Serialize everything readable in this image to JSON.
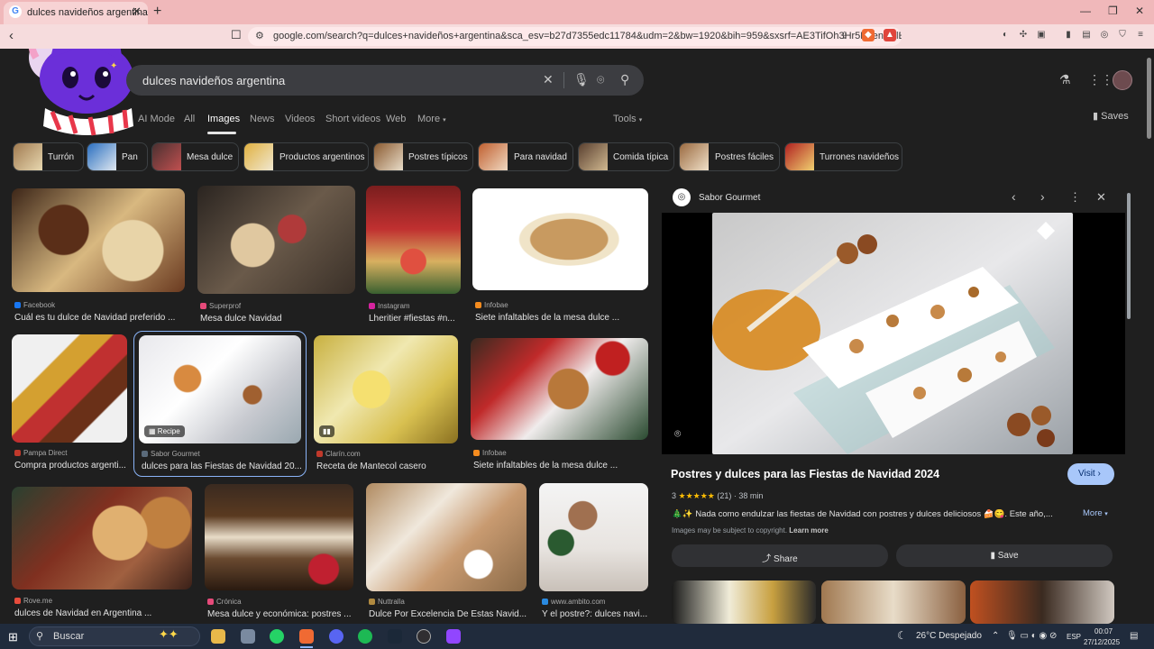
{
  "browser": {
    "tab_title": "dulces navideños argentina",
    "url": "google.com/search?q=dulces+navideños+argentina&sca_esv=b27d7355edc11784&udm=2&bw=1920&bih=959&sxsrf=AE3TifOh3Hr5K7engNlE8to...",
    "google_logo_letter": "G"
  },
  "search": {
    "query": "dulces navideños argentina"
  },
  "header": {
    "saves_label": "Saves"
  },
  "nav_tabs": [
    "AI Mode",
    "All",
    "Images",
    "News",
    "Videos",
    "Short videos",
    "Web",
    "More",
    "Tools"
  ],
  "chips": [
    "Turrón",
    "Pan",
    "Mesa dulce",
    "Productos argentinos",
    "Postres típicos",
    "Para navidad",
    "Comida típica",
    "Postres fáciles",
    "Turrones navideños"
  ],
  "results": [
    {
      "source": "Facebook",
      "title": "Cuál es tu dulce de Navidad preferido ..."
    },
    {
      "source": "Superprof",
      "title": "Mesa dulce Navidad"
    },
    {
      "source": "Instagram",
      "title": "Lheritier #fiestas #n..."
    },
    {
      "source": "Infobae",
      "title": "Siete infaltables de la mesa dulce ..."
    },
    {
      "source": "Pampa Direct",
      "title": "Compra productos argenti..."
    },
    {
      "source": "Sabor Gourmet",
      "title": "dulces para las Fiestas de Navidad 20...",
      "badge": "Recipe"
    },
    {
      "source": "Clarín.com",
      "title": "Receta de Mantecol casero"
    },
    {
      "source": "Infobae",
      "title": "Siete infaltables de la mesa dulce ..."
    },
    {
      "source": "Rove.me",
      "title": "dulces de Navidad en Argentina ..."
    },
    {
      "source": "Crónica",
      "title": "Mesa dulce y económica: postres ..."
    },
    {
      "source": "Nuttralla",
      "title": "Dulce Por Excelencia De Estas Navid..."
    },
    {
      "source": "www.ambito.com",
      "title": "Y el postre?: dulces navi..."
    }
  ],
  "panel": {
    "source": "Sabor Gourmet",
    "title": "Postres y dulces para las Fiestas de Navidad 2024",
    "rating": "3",
    "stars": "★★★★★",
    "reviews": "(21)",
    "time": "38 min",
    "description": "🎄✨ Nada como endulzar las fiestas de Navidad con postres y dulces deliciosos 🍰😋. Este año,...",
    "more_label": "More",
    "copyright": "Images may be subject to copyright.",
    "learn_more": "Learn more",
    "visit_label": "Visit",
    "share_label": "Share",
    "save_label": "Save"
  },
  "taskbar": {
    "search_label": "Buscar",
    "weather": "26°C  Despejado",
    "lang": "ESP",
    "time": "00:07",
    "date": "27/12/2025"
  },
  "colors": {
    "accent": "#8ab4f8",
    "visit_button": "#a8c7fa",
    "tab_strip": "#f0b8ba",
    "page_bg": "#1f1f1f",
    "taskbar": "#202b3c"
  }
}
